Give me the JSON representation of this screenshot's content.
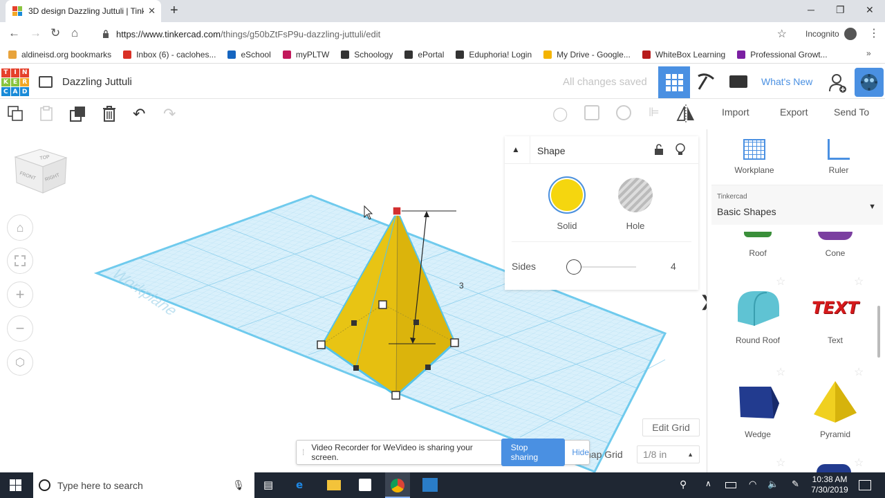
{
  "browser": {
    "tab_title": "3D design Dazzling Juttuli | Tinke",
    "url_domain": "https://www.tinkercad.com",
    "url_path": "/things/g50bZtFsP9u-dazzling-juttuli/edit",
    "incognito_label": "Incognito",
    "bookmarks": [
      {
        "label": "aldineisd.org bookmarks",
        "color": "#e8a33c"
      },
      {
        "label": "Inbox (6) - caclohes...",
        "color": "#d93025"
      },
      {
        "label": "eSchool",
        "color": "#1565c0"
      },
      {
        "label": "myPLTW",
        "color": "#c2185b"
      },
      {
        "label": "Schoology",
        "color": "#333333"
      },
      {
        "label": "ePortal",
        "color": "#333333"
      },
      {
        "label": "Eduphoria! Login",
        "color": "#333333"
      },
      {
        "label": "My Drive - Google...",
        "color": "#f4b400"
      },
      {
        "label": "WhiteBox Learning",
        "color": "#b71c1c"
      },
      {
        "label": "Professional Growt...",
        "color": "#7b1fa2"
      }
    ]
  },
  "app": {
    "logo_letters": [
      "T",
      "I",
      "N",
      "K",
      "E",
      "R",
      "C",
      "A",
      "D"
    ],
    "logo_colors": [
      "#e5412c",
      "#e5412c",
      "#e5412c",
      "#8ac43f",
      "#8ac43f",
      "#f3a826",
      "#1a8bd8",
      "#1a8bd8",
      "#1a8bd8"
    ],
    "design_title": "Dazzling Juttuli",
    "save_status": "All changes saved",
    "whats_new": "What's New",
    "import": "Import",
    "export": "Export",
    "send_to": "Send To",
    "accent": "#4a90e2"
  },
  "viewcube": {
    "top": "TOP",
    "front": "FRONT",
    "right": "RIGHT"
  },
  "viewport": {
    "dimension_label": "3",
    "workplane_watermark": "Workplane"
  },
  "shape_panel": {
    "title": "Shape",
    "solid_label": "Solid",
    "hole_label": "Hole",
    "solid_color": "#f5d60f",
    "sides_label": "Sides",
    "sides_value": "4"
  },
  "right_panel": {
    "workplane": "Workplane",
    "ruler": "Ruler",
    "library_source": "Tinkercad",
    "library_name": "Basic Shapes",
    "shapes": [
      {
        "label": "Roof"
      },
      {
        "label": "Cone"
      },
      {
        "label": "Round Roof"
      },
      {
        "label": "Text"
      },
      {
        "label": "Wedge"
      },
      {
        "label": "Pyramid"
      }
    ],
    "text_shape_letters": "TEXT"
  },
  "grid": {
    "edit_grid": "Edit Grid",
    "snap_label": "nap Grid",
    "snap_value": "1/8 in"
  },
  "share_bar": {
    "message": "Video Recorder for WeVideo is sharing your screen.",
    "stop": "Stop sharing",
    "hide": "Hide"
  },
  "taskbar": {
    "search_placeholder": "Type here to search",
    "time": "10:38 AM",
    "date": "7/30/2019"
  }
}
